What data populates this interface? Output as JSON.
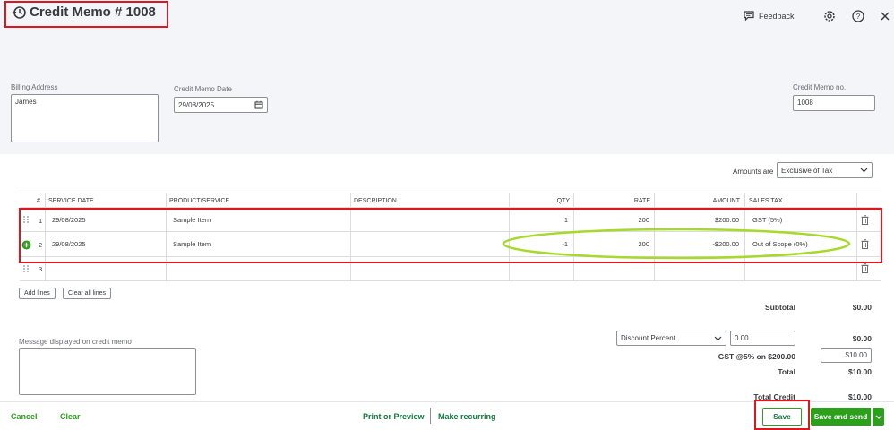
{
  "header": {
    "title": "Credit Memo # 1008",
    "feedback_label": "Feedback",
    "icons": [
      "history-icon",
      "feedback-icon",
      "gear-icon",
      "help-icon",
      "close-icon"
    ]
  },
  "form": {
    "billing_address_label": "Billing Address",
    "billing_address_value": "James",
    "date_label": "Credit Memo Date",
    "date_value": "29/08/2025",
    "memo_no_label": "Credit Memo no.",
    "memo_no_value": "1008"
  },
  "amounts_are": {
    "label": "Amounts are",
    "value": "Exclusive of Tax"
  },
  "table": {
    "headers": {
      "num": "#",
      "service_date": "SERVICE DATE",
      "product": "PRODUCT/SERVICE",
      "description": "DESCRIPTION",
      "qty": "QTY",
      "rate": "RATE",
      "amount": "AMOUNT",
      "sales_tax": "SALES TAX"
    },
    "rows": [
      {
        "num": "1",
        "date": "29/08/2025",
        "product": "Sample Item",
        "description": "",
        "qty": "1",
        "rate": "200",
        "amount": "$200.00",
        "tax": "GST (5%)"
      },
      {
        "num": "2",
        "date": "29/08/2025",
        "product": "Sample Item",
        "description": "",
        "qty": "-1",
        "rate": "200",
        "amount": "-$200.00",
        "tax": "Out of Scope (0%)"
      },
      {
        "num": "3",
        "date": "",
        "product": "",
        "description": "",
        "qty": "",
        "rate": "",
        "amount": "",
        "tax": ""
      }
    ],
    "add_lines_label": "Add lines",
    "clear_lines_label": "Clear all lines"
  },
  "message": {
    "label": "Message displayed on credit memo",
    "value": ""
  },
  "totals": {
    "subtotal_label": "Subtotal",
    "subtotal_value": "$0.00",
    "discount_type": "Discount Percent",
    "discount_input": "0.00",
    "discount_value": "$0.00",
    "gst_label": "GST @5% on $200.00",
    "gst_input": "$10.00",
    "total_label": "Total",
    "total_value": "$10.00",
    "total_credit_label": "Total Credit",
    "total_credit_value": "$10.00"
  },
  "footer": {
    "cancel": "Cancel",
    "clear": "Clear",
    "print_preview": "Print or Preview",
    "make_recurring": "Make recurring",
    "save": "Save",
    "save_and_send": "Save and send"
  },
  "colors": {
    "brand_green": "#2ca01c",
    "annotation_red": "#e0161e",
    "annotation_lime": "#a6d92a"
  }
}
